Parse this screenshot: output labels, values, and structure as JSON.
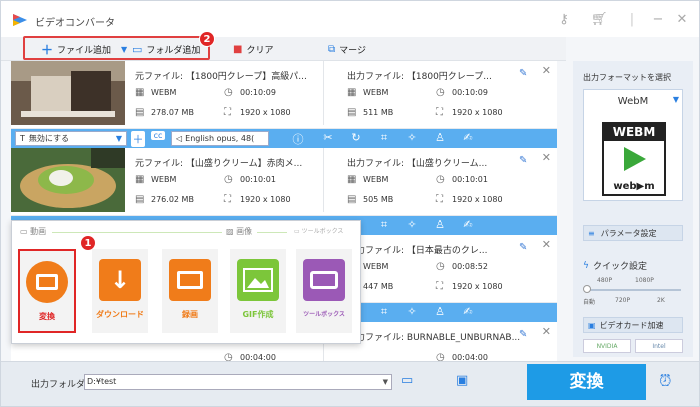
{
  "window": {
    "title": "ビデオコンバータ"
  },
  "toolbar": {
    "add_file": "ファイル追加",
    "add_folder": "フォルダ追加",
    "clear": "クリア",
    "merge": "マージ"
  },
  "badges": {
    "one": "1",
    "two": "2"
  },
  "rows": [
    {
      "src_name": "元ファイル: 【1800円クレープ】高級パ...",
      "src_format": "WEBM",
      "src_duration": "00:10:09",
      "src_size": "278.07 MB",
      "src_res": "1920 x 1080",
      "out_name": "出力ファイル: 【1800円クレープ...",
      "out_format": "WEBM",
      "out_duration": "00:10:09",
      "out_size": "511 MB",
      "out_res": "1920 x 1080"
    },
    {
      "src_name": "元ファイル: 【山盛りクリーム】赤肉メ...",
      "src_format": "WEBM",
      "src_duration": "00:10:01",
      "src_size": "276.02 MB",
      "src_res": "1920 x 1080",
      "out_name": "出力ファイル: 【山盛りクリーム...",
      "out_format": "WEBM",
      "out_duration": "00:10:01",
      "out_size": "505 MB",
      "out_res": "1920 x 1080"
    },
    {
      "out_name": "出力ファイル: 【日本最古のクレ...",
      "out_format": "WEBM",
      "out_duration": "00:08:52",
      "out_size": "447 MB",
      "out_res": "1920 x 1080"
    },
    {
      "out_name": "出力ファイル: BURNABLE_UNBURNAB...",
      "src_duration": "00:04:00",
      "out_duration": "00:04:00"
    }
  ],
  "edit_bar": {
    "subtitle": "無効にする",
    "audio": "English opus, 48(",
    "cc": "cc"
  },
  "popup": {
    "cat_video": "動画",
    "cat_image": "画像",
    "cat_toolbox": "ツールボックス",
    "tiles": [
      "変換",
      "ダウンロード",
      "録画",
      "GIF作成",
      "ツールボックス"
    ]
  },
  "right_panel": {
    "select_format": "出力フォーマットを選択",
    "format": "WebM",
    "format_logo_top": "WEBM",
    "format_logo_bottom": "web▶m",
    "param": "パラメータ設定",
    "quick": "クイック設定",
    "q_480": "480P",
    "q_1080": "1080P",
    "q_auto": "自動",
    "q_720": "720P",
    "q_2k": "2K",
    "gpu": "ビデオカード加速",
    "nvidia": "NVIDIA",
    "intel": "Intel"
  },
  "bottom": {
    "folder_label": "出力フォルダ:",
    "folder_value": "D:¥test",
    "convert": "変換"
  },
  "colors": {
    "accent": "#1e9be6",
    "orange": "#f07c1a",
    "red": "#e02626"
  }
}
